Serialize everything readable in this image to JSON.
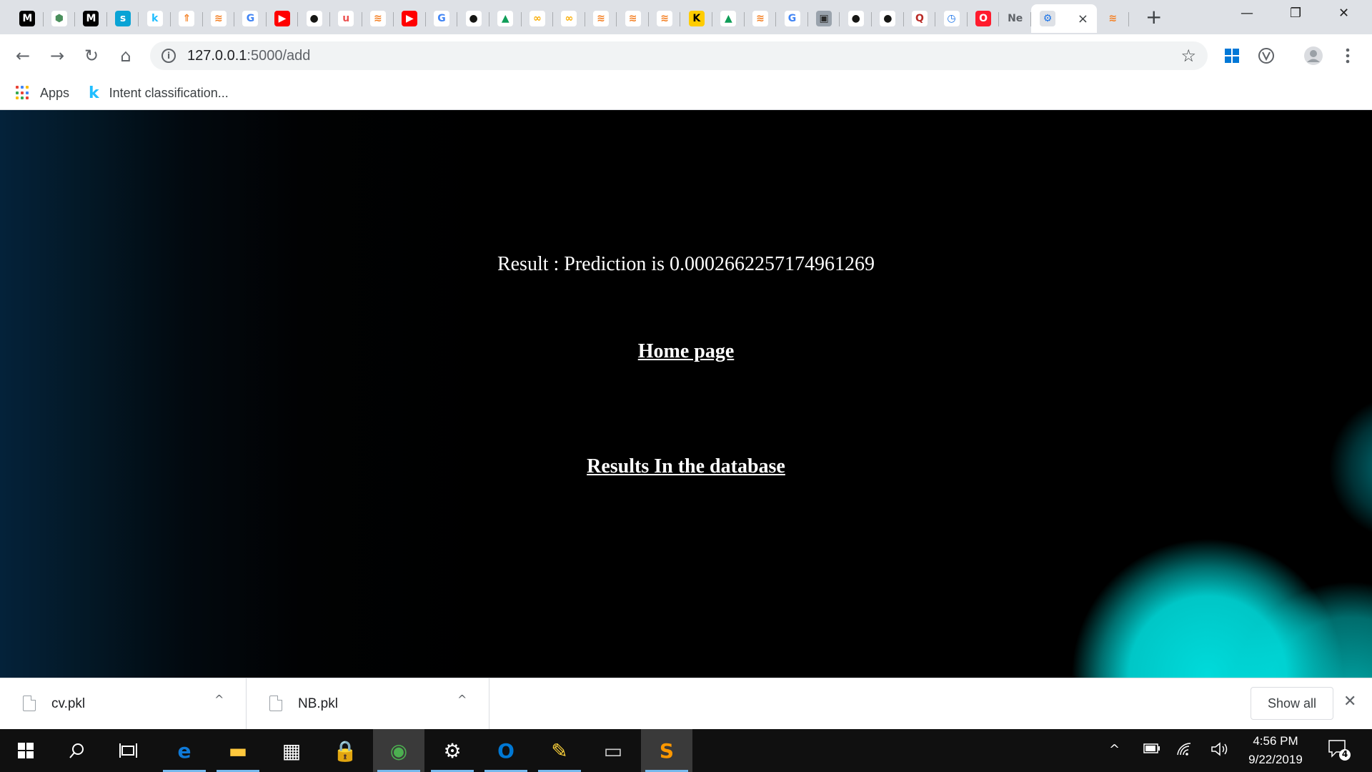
{
  "browser": {
    "tabs": [
      {
        "icon": "medium-icon",
        "glyph": "M",
        "bg": "#000000",
        "fg": "#ffffff"
      },
      {
        "icon": "hexagon-icon",
        "glyph": "⬢",
        "bg": "#ffffff",
        "fg": "#4a8f5c"
      },
      {
        "icon": "medium-icon",
        "glyph": "M",
        "bg": "#000000",
        "fg": "#ffffff"
      },
      {
        "icon": "spacy-icon",
        "glyph": "s",
        "bg": "#09a3d5",
        "fg": "#ffffff"
      },
      {
        "icon": "kaggle-icon",
        "glyph": "k",
        "bg": "#ffffff",
        "fg": "#20beff"
      },
      {
        "icon": "arrow-up-icon",
        "glyph": "⇑",
        "bg": "#ffffff",
        "fg": "#f48024"
      },
      {
        "icon": "stackoverflow-icon",
        "glyph": "≋",
        "bg": "#ffffff",
        "fg": "#f48024"
      },
      {
        "icon": "google-icon",
        "glyph": "G",
        "bg": "#ffffff",
        "fg": "#4285f4"
      },
      {
        "icon": "youtube-icon",
        "glyph": "▶",
        "bg": "#ff0000",
        "fg": "#ffffff"
      },
      {
        "icon": "github-icon",
        "glyph": "●",
        "bg": "#ffffff",
        "fg": "#161614"
      },
      {
        "icon": "udemy-icon",
        "glyph": "u",
        "bg": "#ffffff",
        "fg": "#ec5252"
      },
      {
        "icon": "stackoverflow-icon",
        "glyph": "≋",
        "bg": "#ffffff",
        "fg": "#f48024"
      },
      {
        "icon": "youtube-icon",
        "glyph": "▶",
        "bg": "#ff0000",
        "fg": "#ffffff"
      },
      {
        "icon": "google-icon",
        "glyph": "G",
        "bg": "#ffffff",
        "fg": "#4285f4"
      },
      {
        "icon": "github-icon",
        "glyph": "●",
        "bg": "#ffffff",
        "fg": "#161614"
      },
      {
        "icon": "drive-icon",
        "glyph": "▲",
        "bg": "#ffffff",
        "fg": "#0f9d58"
      },
      {
        "icon": "colab-icon",
        "glyph": "∞",
        "bg": "#ffffff",
        "fg": "#f9ab00"
      },
      {
        "icon": "colab-icon",
        "glyph": "∞",
        "bg": "#ffffff",
        "fg": "#f9ab00"
      },
      {
        "icon": "stackoverflow-icon",
        "glyph": "≋",
        "bg": "#ffffff",
        "fg": "#f48024"
      },
      {
        "icon": "stackoverflow-icon",
        "glyph": "≋",
        "bg": "#ffffff",
        "fg": "#f48024"
      },
      {
        "icon": "stackoverflow-icon",
        "glyph": "≋",
        "bg": "#ffffff",
        "fg": "#f48024"
      },
      {
        "icon": "k-logo-icon",
        "glyph": "K",
        "bg": "#ffcc00",
        "fg": "#000000"
      },
      {
        "icon": "drive-icon",
        "glyph": "▲",
        "bg": "#ffffff",
        "fg": "#0f9d58"
      },
      {
        "icon": "stackoverflow-icon",
        "glyph": "≋",
        "bg": "#ffffff",
        "fg": "#f48024"
      },
      {
        "icon": "google-icon",
        "glyph": "G",
        "bg": "#ffffff",
        "fg": "#4285f4"
      },
      {
        "icon": "avatar-image-icon",
        "glyph": "▣",
        "bg": "#9aa3ad",
        "fg": "#2b2b2b"
      },
      {
        "icon": "github-icon",
        "glyph": "●",
        "bg": "#ffffff",
        "fg": "#161614"
      },
      {
        "icon": "github-icon",
        "glyph": "●",
        "bg": "#ffffff",
        "fg": "#161614"
      },
      {
        "icon": "quora-icon",
        "glyph": "Q",
        "bg": "#ffffff",
        "fg": "#b92b27"
      },
      {
        "icon": "history-icon",
        "glyph": "◷",
        "bg": "#ffffff",
        "fg": "#1a73e8"
      },
      {
        "icon": "opera-icon",
        "glyph": "O",
        "bg": "#ff1b2d",
        "fg": "#ffffff"
      },
      {
        "icon": "ne-text-icon",
        "glyph": "Ne",
        "bg": "#dee1e6",
        "fg": "#5f6368"
      },
      {
        "icon": "gear-icon",
        "glyph": "⚙",
        "bg": "#dee1e6",
        "fg": "#1a73e8"
      }
    ],
    "trailing_tab": {
      "icon": "stackoverflow-icon",
      "glyph": "≋",
      "fg": "#f48024"
    },
    "active_tab_close": "×",
    "new_tab": "+",
    "window_controls": {
      "minimize": "—",
      "restore": "❐",
      "close": "✕"
    },
    "toolbar": {
      "back": "←",
      "forward": "→",
      "reload": "↻",
      "home": "⌂",
      "info": "i",
      "url_host": "127.0.0.1",
      "url_path": ":5000/add",
      "bookmark_star": "☆"
    },
    "extensions": [
      {
        "icon": "windows-extension-icon",
        "color": "#0078d7"
      },
      {
        "icon": "v-extension-icon",
        "color": "#5f6368"
      },
      {
        "icon": "profile-avatar-icon",
        "color": "#9aa0a6"
      },
      {
        "icon": "menu-kebab-icon",
        "color": "#5f6368"
      }
    ],
    "bookmarks": [
      {
        "label": "Apps",
        "icon": "apps-grid-icon"
      },
      {
        "label": "Intent classification...",
        "icon": "kaggle-icon",
        "glyph": "k"
      }
    ]
  },
  "page": {
    "result_text": "Result : Prediction is 0.0002662257174961269",
    "home_link": "Home page",
    "results_link": "Results In the database"
  },
  "downloads": {
    "items": [
      {
        "name": "cv.pkl",
        "chevron": "^"
      },
      {
        "name": "NB.pkl",
        "chevron": "^"
      }
    ],
    "show_all": "Show all",
    "close": "✕"
  },
  "taskbar": {
    "apps": [
      {
        "name": "edge-icon",
        "glyph": "e",
        "color": "#0f7ad8",
        "underline": true,
        "active": false
      },
      {
        "name": "file-explorer-icon",
        "glyph": "▬",
        "color": "#ffc83d",
        "underline": true,
        "active": false
      },
      {
        "name": "store-icon",
        "glyph": "▦",
        "color": "#ffffff",
        "underline": false,
        "active": false
      },
      {
        "name": "lock-app-icon",
        "glyph": "🔒",
        "color": "#f0c419",
        "underline": false,
        "active": false
      },
      {
        "name": "chrome-icon",
        "glyph": "◉",
        "color": "#4caf50",
        "underline": true,
        "active": true
      },
      {
        "name": "settings-icon",
        "glyph": "⚙",
        "color": "#ffffff",
        "underline": true,
        "active": false
      },
      {
        "name": "outlook-icon",
        "glyph": "O",
        "color": "#0078d4",
        "underline": true,
        "active": false
      },
      {
        "name": "python-icon",
        "glyph": "✎",
        "color": "#ffd43b",
        "underline": true,
        "active": false
      },
      {
        "name": "terminal-icon",
        "glyph": "▭",
        "color": "#cccccc",
        "underline": false,
        "active": false
      },
      {
        "name": "sublime-icon",
        "glyph": "S",
        "color": "#ff9800",
        "underline": true,
        "active": true
      }
    ],
    "tray": {
      "chevron": "^",
      "battery": "▭",
      "wifi": "((·",
      "volume": "🔈"
    },
    "time": "4:56 PM",
    "date": "9/22/2019",
    "notifications_count": "4"
  }
}
